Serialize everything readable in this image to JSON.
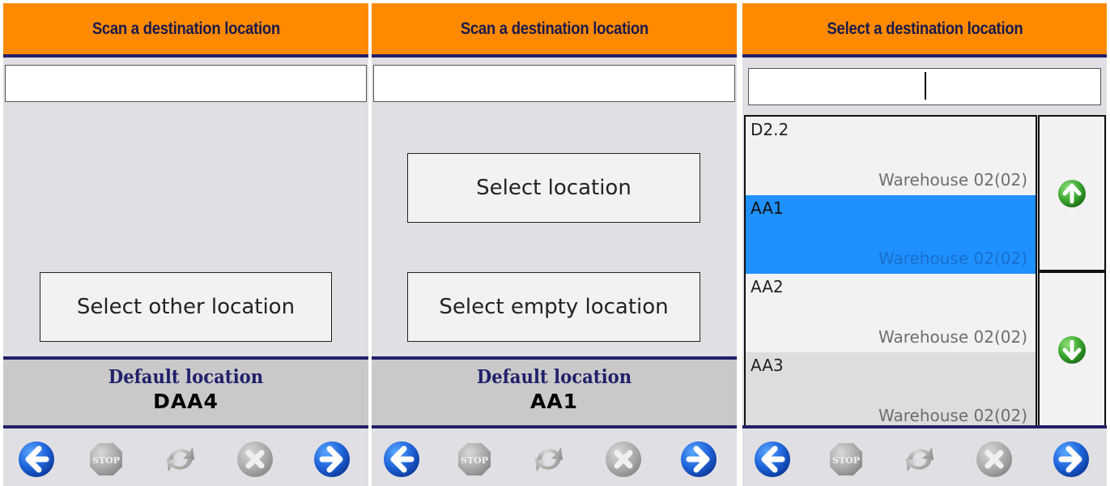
{
  "panels": [
    {
      "title": "Scan a destination location",
      "input_value": "",
      "buttons": [
        "Select other location"
      ],
      "default_label": "Default location",
      "default_value": "DAA4"
    },
    {
      "title": "Scan a destination location",
      "input_value": "",
      "buttons": [
        "Select location",
        "Select empty location"
      ],
      "default_label": "Default location",
      "default_value": "AA1"
    },
    {
      "title": "Select a destination location",
      "input_value": "",
      "locations": [
        {
          "code": "D2.2",
          "warehouse": "Warehouse 02(02)",
          "selected": false,
          "shade": "#f2f2f2"
        },
        {
          "code": "AA1",
          "warehouse": "Warehouse 02(02)",
          "selected": true,
          "shade": "#1e90ff"
        },
        {
          "code": "AA2",
          "warehouse": "Warehouse 02(02)",
          "selected": false,
          "shade": "#f2f2f2"
        },
        {
          "code": "AA3",
          "warehouse": "Warehouse 02(02)",
          "selected": false,
          "shade": "#dddddd"
        }
      ],
      "scroll_icons": [
        "arrow-up-icon",
        "arrow-down-icon"
      ]
    }
  ],
  "nav_icons": [
    "back-arrow-icon",
    "stop-icon",
    "refresh-icon",
    "cancel-icon",
    "forward-arrow-icon"
  ],
  "colors": {
    "header": "#ff8a00",
    "header_text": "#1a1a4a",
    "divider": "#20206b",
    "selected_row": "#1e90ff",
    "nav_blue": "#1e62d8",
    "scroll_green": "#3aa52e"
  }
}
